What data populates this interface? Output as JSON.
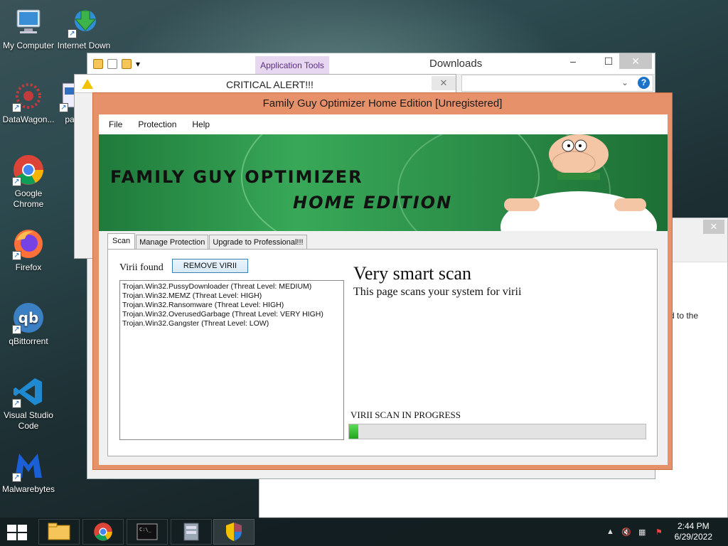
{
  "desktop": {
    "icons": [
      {
        "label": "My Computer",
        "icon": "computer-icon"
      },
      {
        "label": "Internet Down",
        "icon": "download-manager-icon"
      },
      {
        "label": "DataWagon...",
        "icon": "datawagon-icon"
      },
      {
        "label": "pa",
        "icon": "file-icon"
      },
      {
        "label": "Google Chrome",
        "icon": "chrome-icon"
      },
      {
        "label": "Firefox",
        "icon": "firefox-icon"
      },
      {
        "label": "qBittorrent",
        "icon": "qbittorrent-icon"
      },
      {
        "label": "Visual Studio Code",
        "icon": "vscode-icon"
      },
      {
        "label": "Malwarebytes",
        "icon": "malwarebytes-icon"
      }
    ]
  },
  "explorer": {
    "app_tools_label": "Application Tools",
    "title": "Downloads",
    "minimize": "–",
    "maximize": "☐",
    "close": "✕"
  },
  "critical_alert": {
    "title": "CRITICAL ALERT!!!",
    "close": "✕"
  },
  "background_window": {
    "close": "✕",
    "fragment_text": "d to the"
  },
  "app": {
    "title": "Family Guy Optimizer Home Edition [Unregistered]",
    "menu": [
      "File",
      "Protection",
      "Help"
    ],
    "banner": {
      "line1": "FAMILY GUY OPTIMIZER",
      "line2": "HOME EDITION"
    },
    "tabs": [
      "Scan",
      "Manage Protection",
      "Upgrade to Professional!!!"
    ],
    "active_tab": "Scan",
    "virii_found_label": "Virii found",
    "remove_button": "REMOVE VIRII",
    "virii_list": [
      "Trojan.Win32.PussyDownloader (Threat Level: MEDIUM)",
      "Trojan.Win32.MEMZ (Threat Level: HIGH)",
      "Trojan.Win32.Ransomware (Threat Level: HIGH)",
      "Trojan.Win32.OverusedGarbage (Threat Level: VERY HIGH)",
      "Trojan.Win32.Gangster (Threat Level: LOW)"
    ],
    "heading": "Very smart scan",
    "subheading": "This page scans your system for virii",
    "scan_status": "VIRII SCAN IN PROGRESS",
    "progress_percent": 3
  },
  "taskbar": {
    "buttons": [
      "start-button",
      "file-explorer",
      "chrome",
      "command-prompt",
      "archive-app",
      "security-shield"
    ],
    "time": "2:44 PM",
    "date": "6/29/2022"
  },
  "colors": {
    "app_frame": "#e7916a",
    "banner_green": "#2c8f49",
    "progress_green": "#1ea61a",
    "apptools_tab": "#e8d7f0"
  }
}
